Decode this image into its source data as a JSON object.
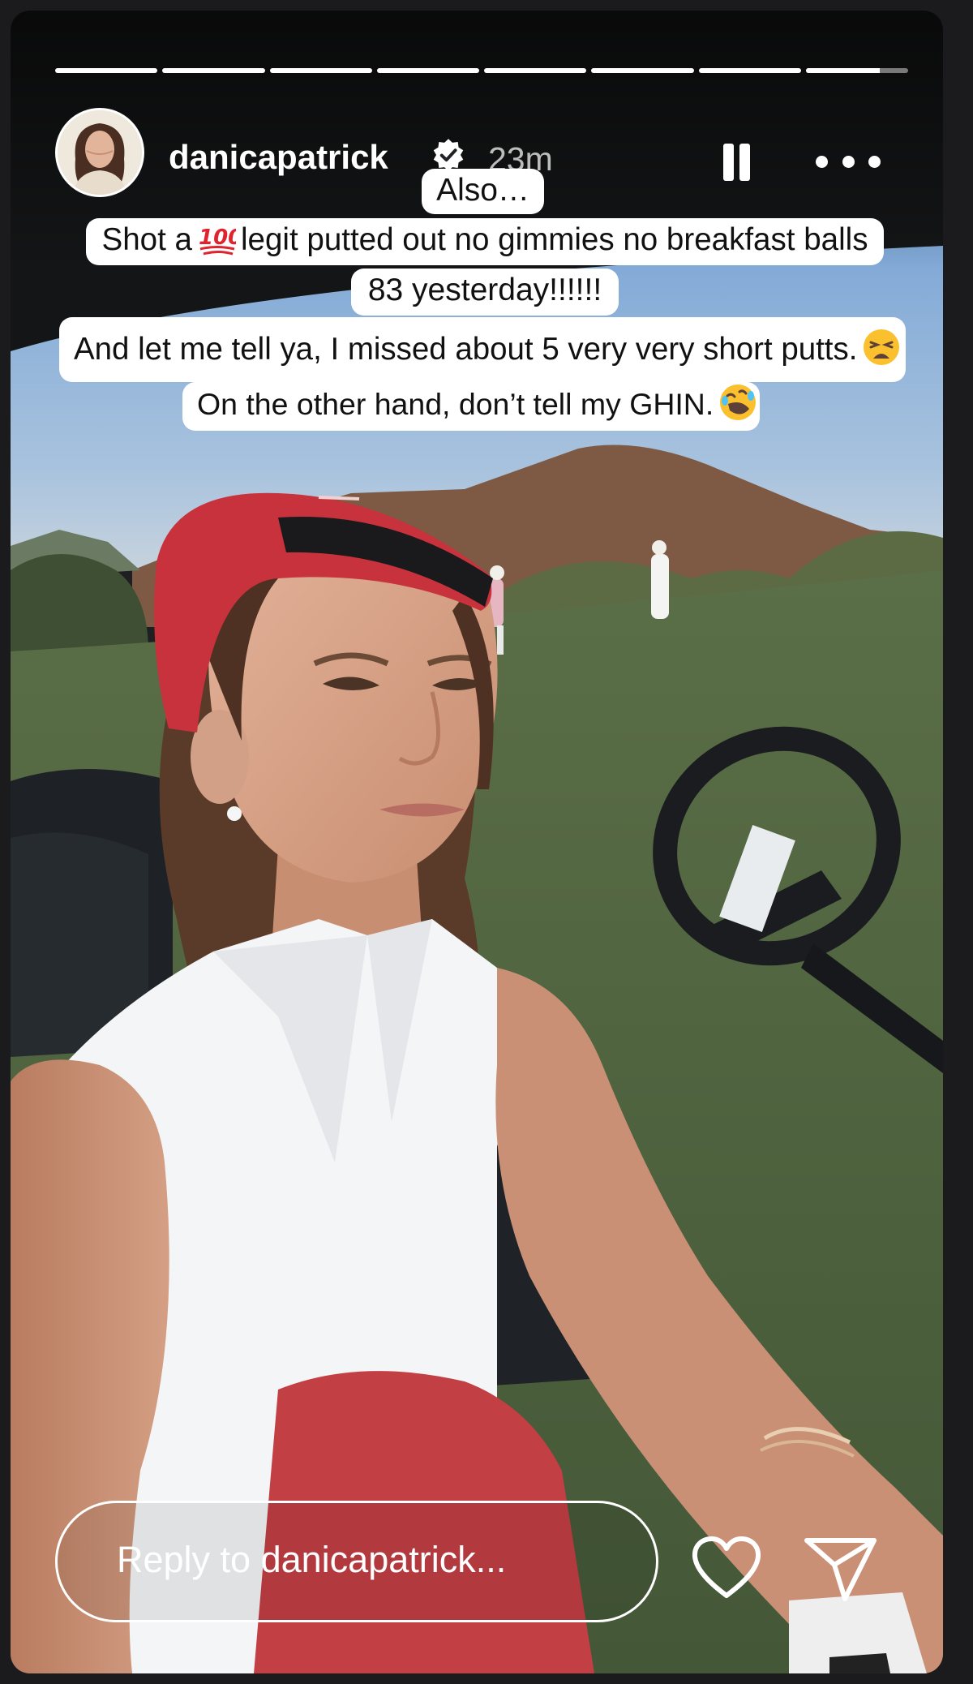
{
  "story": {
    "username": "danicapatrick",
    "time_ago": "23m",
    "progress": {
      "segments": 8,
      "completed": 7,
      "current_fraction": 0.72
    },
    "captions": [
      {
        "text": "Also…"
      },
      {
        "before": "Shot a ",
        "emoji": "hundred-points-emoji",
        "after": " legit putted out no gimmies no breakfast balls"
      },
      {
        "text": "83 yesterday!!!!!!"
      },
      {
        "text": "And let me tell ya, I missed about 5 very very short putts.",
        "emoji": "weary-face-emoji"
      },
      {
        "text": "On the other hand, don’t tell my GHIN.",
        "emoji": "rolling-on-floor-laughing-emoji"
      }
    ]
  },
  "reply": {
    "placeholder": "Reply to danicapatrick..."
  },
  "icons": {
    "verified": "verified-badge-icon",
    "pause": "pause-icon",
    "more": "more-options-icon",
    "like": "heart-icon",
    "share": "send-icon"
  },
  "colors": {
    "frame_background": "#1b1b1d",
    "verified_badge": "#ffffff",
    "caption_background": "#ffffff",
    "cap_red": "#c8323c",
    "fairway_green": "#4f6541"
  }
}
